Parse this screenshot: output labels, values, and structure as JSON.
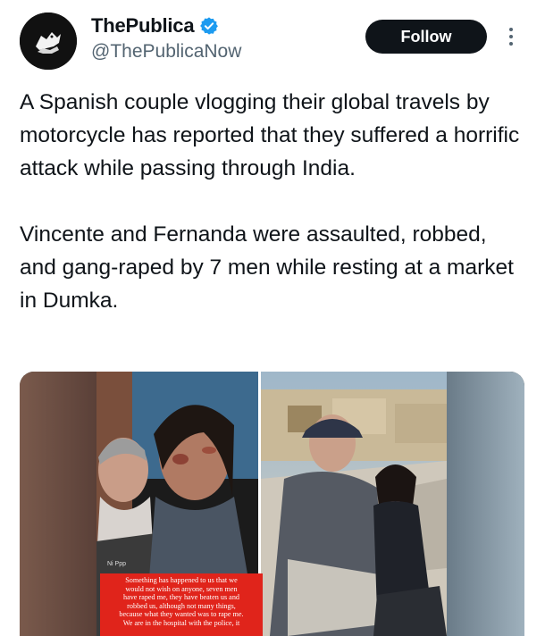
{
  "author": {
    "display_name": "ThePublica",
    "handle": "@ThePublicaNow",
    "verified": true,
    "avatar_icon": "publica-logo-icon"
  },
  "actions": {
    "follow_label": "Follow",
    "more_icon": "more-vertical-icon"
  },
  "tweet": {
    "paragraph_1": "A Spanish couple vlogging their global travels by motorcycle has reported that they suffered a horrific attack while passing through India.",
    "paragraph_2": "Vincente and Fernanda were assaulted, robbed, and gang-raped by 7 men while resting at a market in Dumka."
  },
  "media": {
    "overlay_small_label": "Ni Ppp",
    "caption_lines": [
      "Something has happened to us that we",
      "would not wish on anyone, seven men",
      "have raped me, they have beaten us and",
      "robbed us, although not many things,",
      "because what they wanted was to rape me.",
      "We are in the hospital with the police, it"
    ]
  },
  "colors": {
    "text": "#0f1419",
    "secondary": "#536471",
    "verified_blue": "#1d9bf0",
    "caption_red": "#e0241b"
  }
}
